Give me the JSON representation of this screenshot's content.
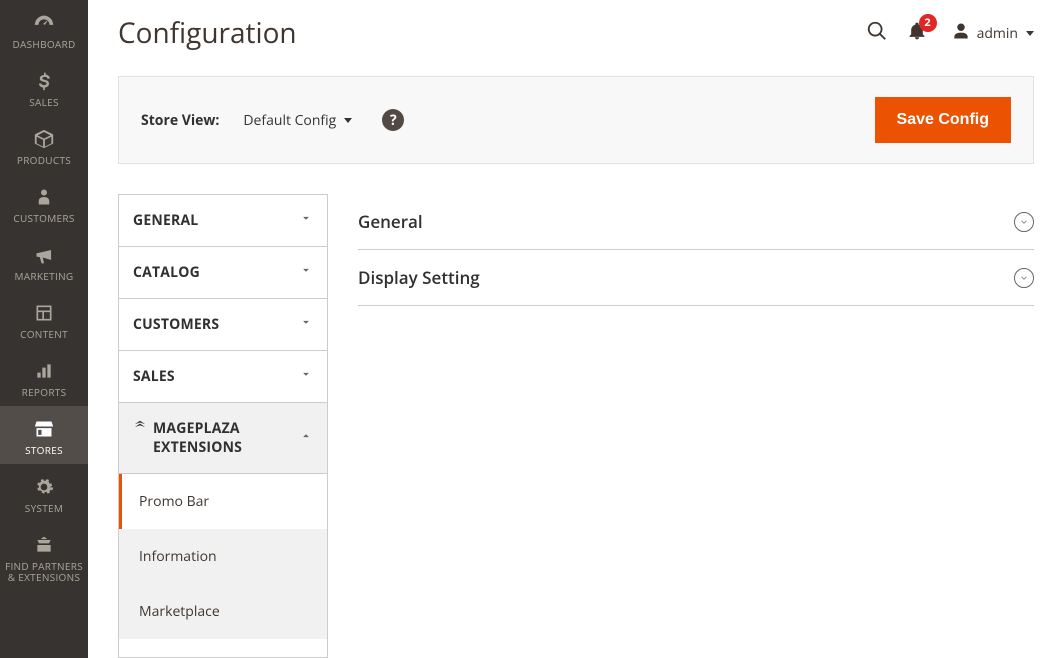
{
  "sidebar": {
    "items": [
      {
        "label": "DASHBOARD",
        "icon": "gauge"
      },
      {
        "label": "SALES",
        "icon": "dollar"
      },
      {
        "label": "PRODUCTS",
        "icon": "box"
      },
      {
        "label": "CUSTOMERS",
        "icon": "person"
      },
      {
        "label": "MARKETING",
        "icon": "megaphone"
      },
      {
        "label": "CONTENT",
        "icon": "layout"
      },
      {
        "label": "REPORTS",
        "icon": "bars"
      },
      {
        "label": "STORES",
        "icon": "store",
        "active": true
      },
      {
        "label": "SYSTEM",
        "icon": "gear"
      },
      {
        "label": "FIND PARTNERS & EXTENSIONS",
        "icon": "partners"
      }
    ]
  },
  "header": {
    "title": "Configuration",
    "notifications_count": "2",
    "user_label": "admin"
  },
  "scope": {
    "label": "Store View:",
    "value": "Default Config",
    "save_label": "Save Config"
  },
  "config_tabs": {
    "sections": [
      {
        "label": "GENERAL"
      },
      {
        "label": "CATALOG"
      },
      {
        "label": "CUSTOMERS"
      },
      {
        "label": "SALES"
      },
      {
        "label": "MAGEPLAZA EXTENSIONS",
        "expanded": true,
        "mp": true
      }
    ],
    "sub_items": [
      {
        "label": "Promo Bar",
        "active": true
      },
      {
        "label": "Information"
      },
      {
        "label": "Marketplace"
      }
    ]
  },
  "accordion": {
    "items": [
      {
        "title": "General"
      },
      {
        "title": "Display Setting"
      }
    ]
  }
}
